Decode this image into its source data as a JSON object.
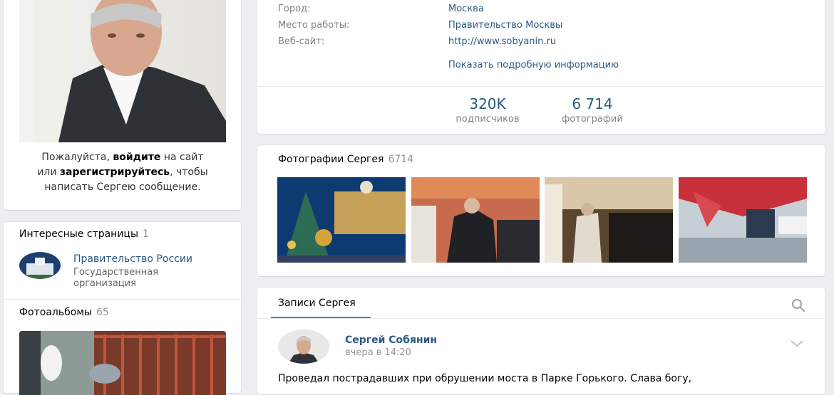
{
  "login_message": {
    "part1": "Пожалуйста, ",
    "login": "войдите",
    "part2": " на сайт",
    "part3": "или ",
    "register": "зарегистрируйтесь",
    "part4": ", чтобы",
    "part5": "написать Сергею сообщение."
  },
  "interesting": {
    "title": "Интересные страницы",
    "count": "1",
    "item": {
      "name": "Правительство России",
      "subtitle": "Государственная организация"
    }
  },
  "albums": {
    "title": "Фотоальбомы",
    "count": "65"
  },
  "info": {
    "rows": [
      {
        "label": "Город:",
        "value": "Москва"
      },
      {
        "label": "Место работы:",
        "value": "Правительство Москвы"
      },
      {
        "label": "Веб-сайт:",
        "value": "http://www.sobyanin.ru"
      }
    ],
    "show_more": "Показать подробную информацию",
    "counters": [
      {
        "value": "320K",
        "label": "подписчиков"
      },
      {
        "value": "6 714",
        "label": "фотографий"
      }
    ]
  },
  "photos": {
    "title": "Фотографии Сергея",
    "count": "6714"
  },
  "wall": {
    "tab": "Записи Сергея",
    "post": {
      "author": "Сергей Собянин",
      "time": "вчера в 14:20",
      "text": "Проведал пострадавших при обрушении моста в Парке Горького. Слава богу,"
    }
  },
  "colors": {
    "link": "#2a5885",
    "accent": "#5181b8",
    "background": "#edeef0"
  },
  "icons": [
    "search-icon",
    "chevron-down-icon"
  ]
}
